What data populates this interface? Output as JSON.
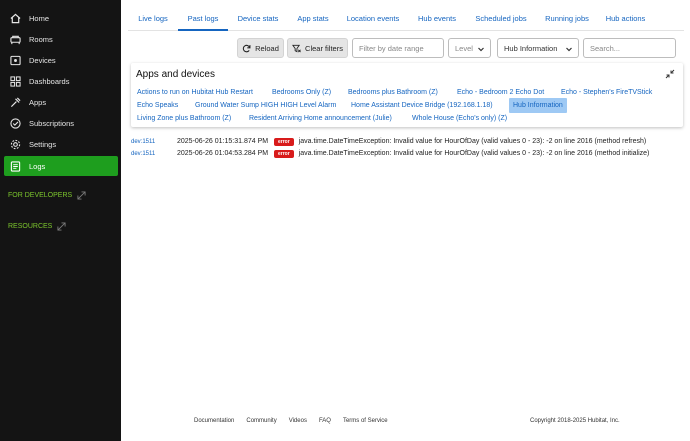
{
  "sidebar": {
    "items": [
      {
        "label": "Home",
        "icon": "home-icon"
      },
      {
        "label": "Rooms",
        "icon": "rooms-icon"
      },
      {
        "label": "Devices",
        "icon": "devices-icon"
      },
      {
        "label": "Dashboards",
        "icon": "dashboards-icon"
      },
      {
        "label": "Apps",
        "icon": "apps-icon"
      },
      {
        "label": "Subscriptions",
        "icon": "subscriptions-icon"
      },
      {
        "label": "Settings",
        "icon": "settings-icon"
      },
      {
        "label": "Logs",
        "icon": "logs-icon",
        "active": true
      }
    ],
    "sections": [
      {
        "label": "FOR DEVELOPERS"
      },
      {
        "label": "RESOURCES"
      }
    ]
  },
  "tabs": [
    "Live logs",
    "Past logs",
    "Device stats",
    "App stats",
    "Location events",
    "Hub events",
    "Scheduled jobs",
    "Running jobs",
    "Hub actions"
  ],
  "active_tab": "Past logs",
  "toolbar": {
    "reload_label": "Reload",
    "clear_filters_label": "Clear filters",
    "date_placeholder": "Filter by date range",
    "level_placeholder": "Level",
    "app_filter_value": "Hub Information",
    "search_placeholder": "Search..."
  },
  "apps_panel": {
    "title": "Apps and devices",
    "items": [
      "Actions to run on Hubitat Hub Restart",
      "Bedrooms Only (Z)",
      "Bedrooms plus Bathroom (Z)",
      "Echo - Bedroom 2 Echo Dot",
      "Echo - Stephen's FireTVStick",
      "Echo Speaks",
      "Ground Water Sump HIGH HIGH Level Alarm",
      "Home Assistant Device Bridge (192.168.1.18)",
      "Hub Information",
      "Living Zone plus Bathroom (Z)",
      "Resident Arriving Home announcement (Julie)",
      "Whole House (Echo's only) (Z)"
    ],
    "selected": "Hub Information"
  },
  "logs": [
    {
      "dev": "dev:1511",
      "time": "2025-06-26 01:15:31.874 PM",
      "level": "error",
      "message": "java.time.DateTimeException: Invalid value for HourOfDay (valid values 0 - 23): -2 on line 2016 (method refresh)"
    },
    {
      "dev": "dev:1511",
      "time": "2025-06-26 01:04:53.284 PM",
      "level": "error",
      "message": "java.time.DateTimeException: Invalid value for HourOfDay (valid values 0 - 23): -2 on line 2016 (method initialize)"
    }
  ],
  "footer": {
    "links": [
      "Documentation",
      "Community",
      "Videos",
      "FAQ",
      "Terms of Service"
    ],
    "copyright": "Copyright 2018-2025 Hubitat, Inc."
  },
  "colors": {
    "sidebar_bg": "#141414",
    "active_green": "#1e9e1e",
    "section_green": "#7cc62d",
    "link_blue": "#1565c0",
    "error_red": "#d81b1b",
    "selected_chip": "#9ec9f4"
  }
}
